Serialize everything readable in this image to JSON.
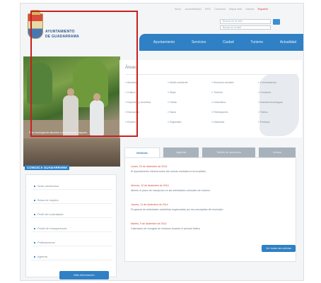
{
  "topnav": {
    "items": [
      "Inicio",
      "Accesibilidad",
      "RSS",
      "Contacto",
      "Mapa web",
      "Idioma"
    ],
    "lang": "Español"
  },
  "search": {
    "placeholder": "Buscar en la web",
    "select_value": "Buscar en la web"
  },
  "logo": {
    "line1": "AYUNTAMIENTO",
    "line2": "DE GUADARRAMA"
  },
  "mainnav": [
    "Ayuntamiento",
    "Servicios",
    "Ciudad",
    "Turismo",
    "Actualidad"
  ],
  "hero": {
    "caption": "Plan municipal de atención a las personas mayores"
  },
  "strip": {
    "label": "CONOZCA GUADARRAMA"
  },
  "left_menu": {
    "items": [
      "Sede electrónica",
      "Bolsa de empleo",
      "Perfil del contratante",
      "Portal de transparencia",
      "Publicaciones",
      "Agenda"
    ],
    "button": "Más información"
  },
  "areas": {
    "title": "Áreas",
    "columns": [
      [
        "Alcaldía",
        "Cultura",
        "Deportes y Juventud",
        "Educación",
        "Empleo"
      ],
      [
        "Medio ambiente",
        "Mujer",
        "Obras",
        "Salud",
        "Seguridad"
      ],
      [
        "Servicios sociales",
        "Turismo",
        "Urbanismo",
        "Participación",
        "Hacienda"
      ],
      [
        "Comunicación",
        "Consumo",
        "Nuevas tecnologías",
        "Tráfico",
        "Festejos"
      ]
    ]
  },
  "tabs": [
    "Noticias",
    "Agenda",
    "Tablón de anuncios",
    "Avisos"
  ],
  "news": {
    "items": [
      {
        "date": "Lunes, 15 de diciembre de 2014",
        "text": "El Ayuntamiento informa sobre las nuevas medidas en la localidad"
      },
      {
        "date": "Viernes, 12 de diciembre de 2014",
        "text": "Abierto el plazo de inscripción en las actividades culturales de invierno"
      },
      {
        "date": "Jueves, 11 de diciembre de 2014",
        "text": "Programa de actividades navideñas organizadas por las concejalías del municipio"
      },
      {
        "date": "Martes, 9 de diciembre de 2014",
        "text": "Calendario de recogida de residuos durante el periodo festivo"
      }
    ],
    "button": "Ver todas las noticias"
  },
  "colors": {
    "accent": "#2f80c4",
    "highlight": "#c8201e",
    "date": "#d0443a"
  }
}
